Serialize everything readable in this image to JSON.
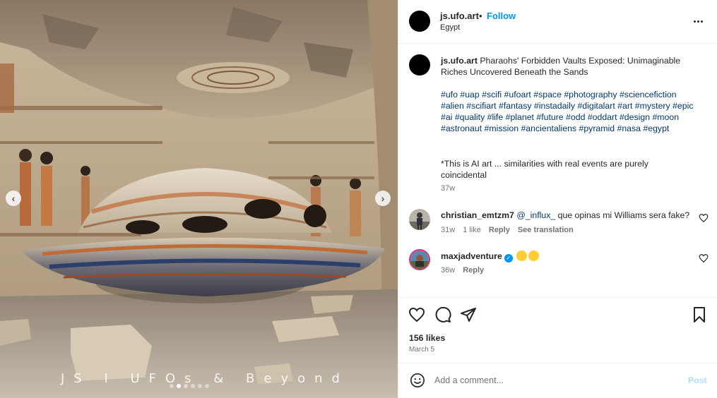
{
  "media": {
    "watermark": "JS I UFOs & Beyond",
    "prev_icon": "chevron-left-icon",
    "next_icon": "chevron-right-icon",
    "carousel_dots": 6,
    "active_dot": 1
  },
  "header": {
    "username": "js.ufo.art",
    "separator": "•",
    "follow_label": "Follow",
    "location": "Egypt",
    "more_icon": "more-options-icon"
  },
  "caption": {
    "username": "js.ufo.art",
    "text": "Pharaohs' Forbidden Vaults Exposed: Unimaginable Riches Uncovered Beneath the Sands",
    "hashtags": "#ufo #uap #scifi #ufoart #space #photography  #sciencefiction #alien #scifiart #fantasy #instadaily #digitalart #art #mystery #epic #ai #quality #life #planet #future #odd #oddart #design #moon #astronaut #mission #ancientaliens #pyramid #nasa #egypt",
    "disclaimer": "*This is AI art ... similarities with real events are purely coincidental",
    "time": "37w"
  },
  "comments": [
    {
      "username": "christian_emtzm7",
      "mention": "@_influx_",
      "text": " que opinas mi Williams sera fake?",
      "time": "31w",
      "likes": "1 like",
      "reply_label": "Reply",
      "translate_label": "See translation"
    },
    {
      "username": "maxjadventure",
      "verified": true,
      "emojis": [
        "star-struck-emoji",
        "astonished-emoji"
      ],
      "time": "36w",
      "reply_label": "Reply"
    }
  ],
  "actions": {
    "likes": "156 likes",
    "date": "March 5"
  },
  "add_comment": {
    "placeholder": "Add a comment...",
    "post_label": "Post"
  },
  "colors": {
    "link_blue": "#0095f6",
    "hashtag_blue": "#00376b",
    "muted": "#737373",
    "post_disabled": "#b3dbff",
    "verified": "#0095f6"
  }
}
